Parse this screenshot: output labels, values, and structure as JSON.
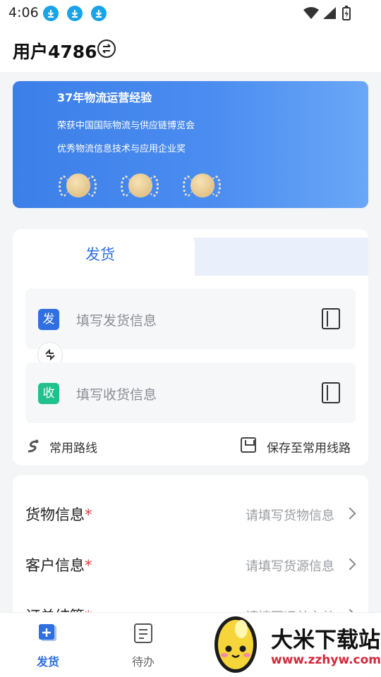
{
  "status_bar": {
    "time": "4:06"
  },
  "header": {
    "title": "用户4786"
  },
  "banner": {
    "title": "37年物流运营经验",
    "line1": "荣获中国国际物流与供应链博览会",
    "line2": "优秀物流信息技术与应用企业奖"
  },
  "ship_card": {
    "tab_label": "发货",
    "sender": {
      "badge": "发",
      "placeholder": "填写发货信息",
      "badge_color": "#2f6fe0"
    },
    "receiver": {
      "badge": "收",
      "placeholder": "填写收货信息",
      "badge_color": "#1fc28a"
    },
    "common_routes": "常用路线",
    "save_route": "保存至常用线路"
  },
  "info": {
    "rows": [
      {
        "label": "货物信息",
        "value": "请填写货物信息"
      },
      {
        "label": "客户信息",
        "value": "请填写货源信息"
      },
      {
        "label": "订单结算",
        "value": "请填写运单主单"
      }
    ],
    "required_mark": "*"
  },
  "bottom_nav": {
    "items": [
      {
        "label": "发货",
        "active": true
      },
      {
        "label": "待办",
        "active": false
      }
    ]
  },
  "watermark": {
    "brand": "大米下载站",
    "url": "www.zzhyw.com"
  },
  "colors": {
    "accent": "#2f6fe0",
    "green": "#1fc28a",
    "required": "#e23b3b"
  }
}
